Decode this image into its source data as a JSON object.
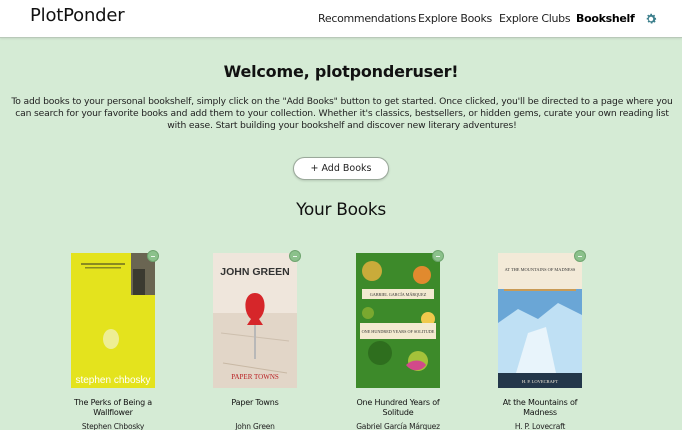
{
  "brand": "PlotPonder",
  "nav": {
    "links": [
      "Recommendations",
      "Explore Books",
      "Explore Clubs",
      "Bookshelf"
    ],
    "settings_icon": "gear-icon"
  },
  "welcome": "Welcome, plotponderuser!",
  "intro": "To add books to your personal bookshelf, simply click on the \"Add Books\" button to get started. Once clicked, you'll be directed to a page where you can search for your favorite books and add them to your collection. Whether it's classics, bestsellers, or hidden gems, curate your own reading list with ease. Start building your bookshelf and discover new literary adventures!",
  "add_button": "+ Add Books",
  "section_title": "Your Books",
  "books": [
    {
      "title": "The Perks of Being a Wallflower",
      "author": "Stephen Chbosky",
      "cover_text": "stephen chbosky",
      "cover_color": "#e4e31d"
    },
    {
      "title": "Paper Towns",
      "author": "John Green",
      "cover_text_top": "JOHN GREEN",
      "cover_text_bottom": "PAPER TOWNS",
      "cover_color": "#efe6dc"
    },
    {
      "title": "One Hundred Years of Solitude",
      "author": "Gabriel García Márquez",
      "cover_text_mid": "GABRIEL GARCÍA MÁRQUEZ",
      "cover_text_bottom": "ONE HUNDRED YEARS OF SOLITUDE",
      "cover_color": "#3d8a2a"
    },
    {
      "title": "At the Mountains of Madness",
      "author": "H. P. Lovecraft",
      "cover_text_top": "AT THE MOUNTAINS OF MADNESS",
      "cover_text_bottom": "H. P. LOVECRAFT",
      "cover_color": "#6aa6d6"
    }
  ]
}
